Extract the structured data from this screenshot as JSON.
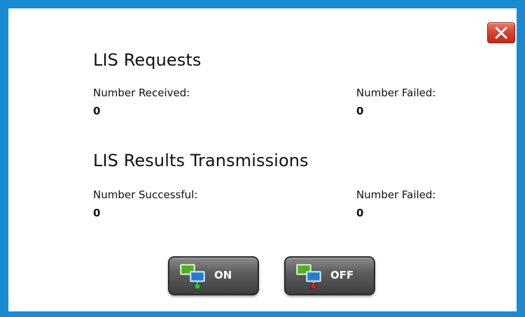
{
  "requests": {
    "title": "LIS Requests",
    "received_label": "Number Received:",
    "received_value": "0",
    "failed_label": "Number Failed:",
    "failed_value": "0"
  },
  "results": {
    "title": "LIS Results Transmissions",
    "successful_label": "Number Successful:",
    "successful_value": "0",
    "failed_label": "Number Failed:",
    "failed_value": "0"
  },
  "controls": {
    "on_label": "ON",
    "off_label": "OFF",
    "on_indicator_color": "#2ec02e",
    "off_indicator_color": "#d42020"
  },
  "icons": {
    "close": "close-icon",
    "network_on": "network-on-icon",
    "network_off": "network-off-icon"
  }
}
